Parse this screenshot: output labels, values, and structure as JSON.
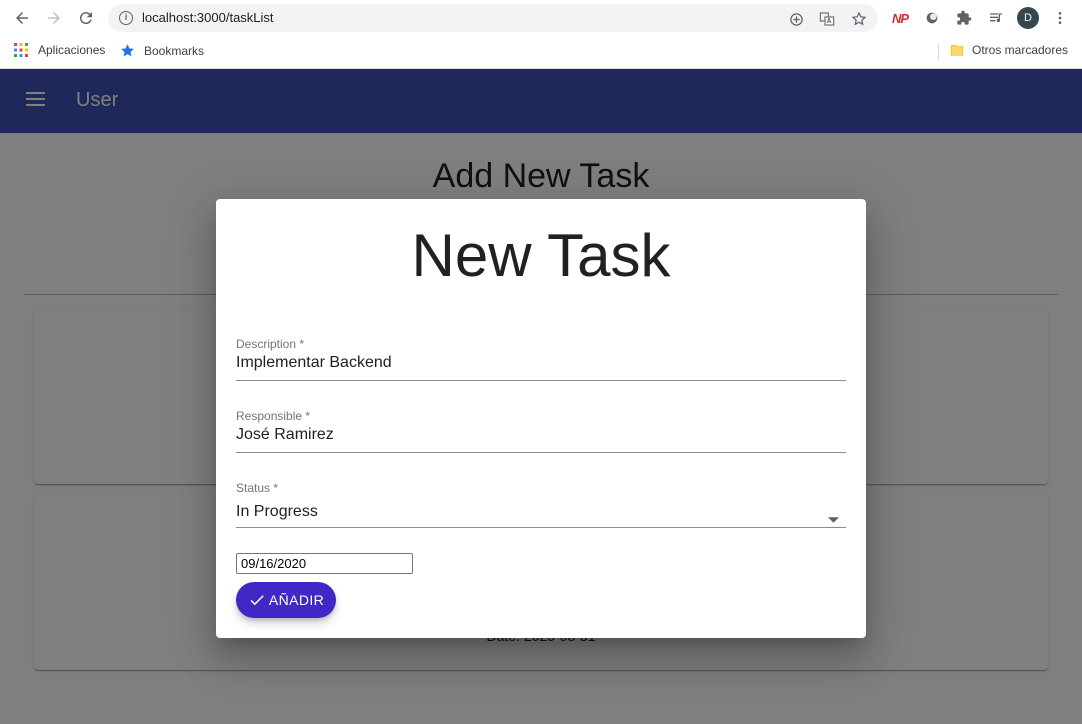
{
  "browser": {
    "url": "localhost:3000/taskList",
    "profile_initial": "D",
    "np_label": "NP",
    "bookmarks": {
      "apps_label": "Aplicaciones",
      "bookmarks_label": "Bookmarks",
      "other_label": "Otros marcadores"
    }
  },
  "appbar": {
    "title": "User",
    "color": "#3f51b5"
  },
  "page": {
    "title": "Add New Task",
    "card_date": "Date: 2020-08-31"
  },
  "dialog": {
    "title": "New Task",
    "fields": [
      {
        "label": "Description *",
        "value": "Implementar Backend"
      },
      {
        "label": "Responsible *",
        "value": "José Ramirez"
      },
      {
        "label": "Status *",
        "value": "In Progress"
      }
    ],
    "date_value": "09/16/2020",
    "submit_label": "AÑADIR",
    "submit_color": "#3f28c5"
  }
}
